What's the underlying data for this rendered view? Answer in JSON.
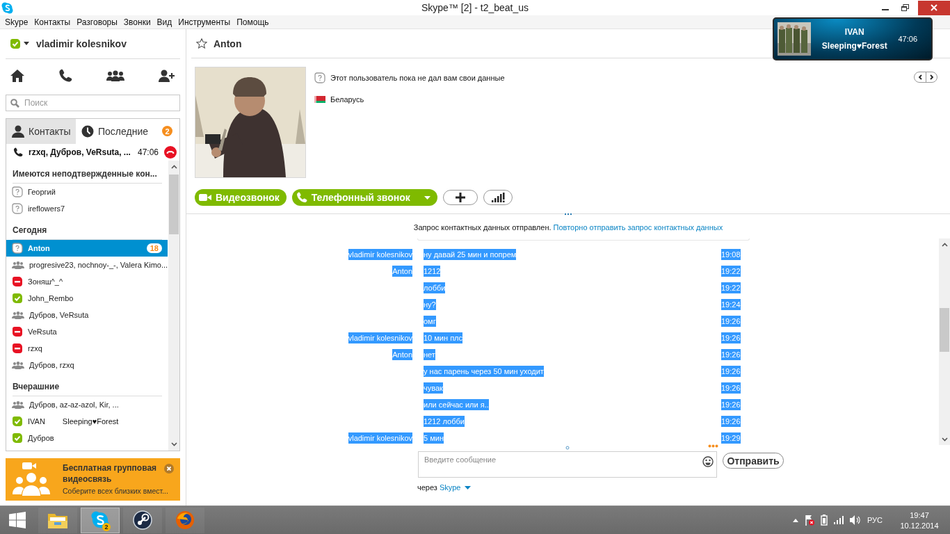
{
  "window": {
    "title": "Skype™ [2] - t2_beat_us"
  },
  "menu": [
    "Skype",
    "Контакты",
    "Разговоры",
    "Звонки",
    "Вид",
    "Инструменты",
    "Помощь"
  ],
  "profile": {
    "name": "vladimir kolesnikov",
    "kind": "online"
  },
  "search": {
    "placeholder": "Поиск"
  },
  "tabs": [
    {
      "label": "Контакты",
      "kind": "contacts",
      "selected": true
    },
    {
      "label": "Последние",
      "kind": "recent",
      "selected": false,
      "badge": "2"
    }
  ],
  "active_call": {
    "names": "rzxq, Дубров, VeRsuta, ...",
    "time": "47:06"
  },
  "sections": [
    {
      "title": "Имеются неподтвержденные кон...",
      "items": [
        {
          "name": "Георгий",
          "kind": "pending",
          "selected": false
        },
        {
          "name": "ireflowers7",
          "kind": "pending",
          "selected": false
        }
      ]
    },
    {
      "title": "Сегодня",
      "items": [
        {
          "name": "Anton",
          "kind": "pending",
          "selected": true,
          "badge": "18"
        },
        {
          "name": "progresive23, nochnoy-_-, Valera Kimo...",
          "kind": "group",
          "selected": false
        },
        {
          "name": "Зоняш^_^",
          "kind": "busy",
          "selected": false
        },
        {
          "name": "John_Rembo",
          "kind": "online",
          "selected": false
        },
        {
          "name": "Дубров, VeRsuta",
          "kind": "group",
          "selected": false
        },
        {
          "name": "VeRsuta",
          "kind": "busy",
          "selected": false
        },
        {
          "name": "rzxq",
          "kind": "busy",
          "selected": false
        },
        {
          "name": "Дубров, rzxq",
          "kind": "group",
          "selected": false
        }
      ]
    },
    {
      "title": "Вчерашние",
      "items": [
        {
          "name": "Дубров, az-az-azol, Kir, ...",
          "kind": "group",
          "selected": false
        },
        {
          "name": "IVAN",
          "kind": "online",
          "selected": false,
          "mood": "Sleeping♥Forest"
        },
        {
          "name": "Дубров",
          "kind": "online",
          "selected": false
        }
      ]
    }
  ],
  "promo": {
    "title": "Бесплатная групповая видеосвязь",
    "text": "Соберите всех близких вмест..."
  },
  "conversation": {
    "contact": {
      "name": "Anton",
      "favorite": false
    },
    "info": "Этот пользователь пока не дал вам свои данные",
    "country": "Беларусь",
    "buttons": [
      {
        "label": "Видеозвонок",
        "kind": "video"
      },
      {
        "label": "Телефонный звонок",
        "kind": "phone"
      }
    ],
    "notice": {
      "text": "Запрос контактных данных отправлен.",
      "link": "Повторно отправить запрос контактных данных"
    },
    "messages": [
      {
        "sender": "vladimir kolesnikov",
        "text": "ну давай 25 мин и попрем",
        "time": "19:08",
        "selected": true
      },
      {
        "sender": "Anton",
        "text": "1212",
        "time": "19:22",
        "selected": true
      },
      {
        "text": "лобби",
        "time": "19:22",
        "selected": true
      },
      {
        "text": "ну?",
        "time": "19:24",
        "selected": true
      },
      {
        "text": "омг",
        "time": "19:26",
        "selected": true
      },
      {
        "sender": "vladimir kolesnikov",
        "text": "10 мин плс",
        "time": "19:26",
        "selected": true
      },
      {
        "sender": "Anton",
        "text": "нет",
        "time": "19:26",
        "selected": true
      },
      {
        "text": "у нас парень через 50 мин уходит",
        "time": "19:26",
        "selected": true
      },
      {
        "text": "чувак",
        "time": "19:26",
        "selected": true
      },
      {
        "text": "или сейчас или я..",
        "time": "19:26",
        "selected": true
      },
      {
        "text": "1212 лобби",
        "time": "19:26",
        "selected": true
      },
      {
        "sender": "vladimir kolesnikov",
        "text": "5 мин",
        "time": "19:29",
        "selected": true
      }
    ],
    "composer": {
      "placeholder": "Введите сообщение",
      "send": "Отправить",
      "via": "через",
      "via_link": "Skype"
    }
  },
  "call_popup": {
    "name": "IVAN",
    "status": "Sleeping♥Forest",
    "time": "47:06"
  },
  "taskbar": {
    "apps": [
      {
        "kind": "explorer",
        "active": false
      },
      {
        "kind": "skype",
        "active": true,
        "badge": "2"
      },
      {
        "kind": "steam",
        "active": false
      },
      {
        "kind": "firefox",
        "active": false
      }
    ],
    "language": "РУС",
    "time": "19:47",
    "date": "10.12.2014"
  }
}
